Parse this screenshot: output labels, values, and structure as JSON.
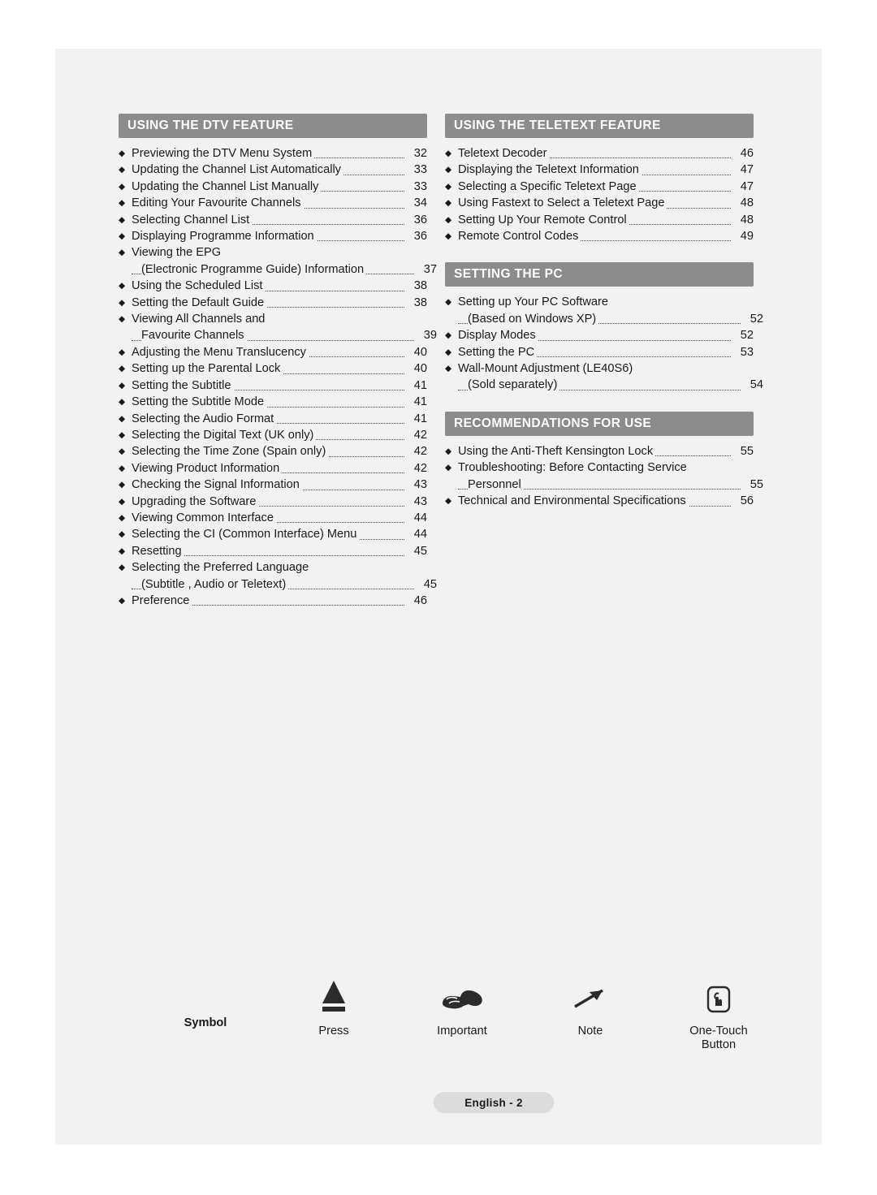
{
  "page": {
    "footer_label": "English - 2"
  },
  "sections": [
    {
      "id": "dtv",
      "title": "USING THE DTV FEATURE",
      "column": "left",
      "items": [
        {
          "text": "Previewing the DTV Menu System",
          "page": "32",
          "bullet": true,
          "dots": true
        },
        {
          "text": "Updating the Channel List Automatically",
          "page": "33",
          "bullet": true,
          "dots": true
        },
        {
          "text": "Updating the Channel List Manually",
          "page": "33",
          "bullet": true,
          "dots": true
        },
        {
          "text": "Editing Your Favourite Channels",
          "page": "34",
          "bullet": true,
          "dots": true
        },
        {
          "text": "Selecting Channel List",
          "page": "36",
          "bullet": true,
          "dots": true
        },
        {
          "text": "Displaying Programme Information",
          "page": "36",
          "bullet": true,
          "dots": true
        },
        {
          "text": "Viewing the EPG",
          "page": "",
          "bullet": true,
          "dots": false
        },
        {
          "text": "(Electronic Programme Guide) Information",
          "page": "37",
          "bullet": false,
          "dots": true,
          "indent": true
        },
        {
          "text": "Using the Scheduled List",
          "page": "38",
          "bullet": true,
          "dots": true
        },
        {
          "text": "Setting the Default Guide",
          "page": "38",
          "bullet": true,
          "dots": true
        },
        {
          "text": "Viewing All Channels and",
          "page": "",
          "bullet": true,
          "dots": false
        },
        {
          "text": "Favourite Channels",
          "page": "39",
          "bullet": false,
          "dots": true,
          "indent": true
        },
        {
          "text": "Adjusting the Menu Translucency",
          "page": "40",
          "bullet": true,
          "dots": true
        },
        {
          "text": "Setting up the Parental Lock",
          "page": "40",
          "bullet": true,
          "dots": true
        },
        {
          "text": "Setting the Subtitle",
          "page": "41",
          "bullet": true,
          "dots": true
        },
        {
          "text": "Setting the Subtitle Mode",
          "page": "41",
          "bullet": true,
          "dots": true
        },
        {
          "text": "Selecting the Audio Format",
          "page": "41",
          "bullet": true,
          "dots": true
        },
        {
          "text": "Selecting the Digital Text (UK only)",
          "page": "42",
          "bullet": true,
          "dots": true
        },
        {
          "text": "Selecting the Time Zone (Spain only)",
          "page": "42",
          "bullet": true,
          "dots": true
        },
        {
          "text": "Viewing Product Information",
          "page": "42",
          "bullet": true,
          "dots": true
        },
        {
          "text": "Checking the Signal Information",
          "page": "43",
          "bullet": true,
          "dots": true
        },
        {
          "text": "Upgrading the Software",
          "page": "43",
          "bullet": true,
          "dots": true
        },
        {
          "text": "Viewing Common Interface",
          "page": "44",
          "bullet": true,
          "dots": true
        },
        {
          "text": "Selecting the CI (Common Interface) Menu",
          "page": "44",
          "bullet": true,
          "dots": true
        },
        {
          "text": "Resetting",
          "page": "45",
          "bullet": true,
          "dots": true
        },
        {
          "text": "Selecting the Preferred Language",
          "page": "",
          "bullet": true,
          "dots": false
        },
        {
          "text": "(Subtitle , Audio or Teletext)",
          "page": "45",
          "bullet": false,
          "dots": true,
          "indent": true
        },
        {
          "text": "Preference",
          "page": "46",
          "bullet": true,
          "dots": true
        }
      ]
    },
    {
      "id": "teletext",
      "title": "USING THE TELETEXT FEATURE",
      "column": "right",
      "items": [
        {
          "text": "Teletext Decoder",
          "page": "46",
          "bullet": true,
          "dots": true
        },
        {
          "text": "Displaying the Teletext Information",
          "page": "47",
          "bullet": true,
          "dots": true
        },
        {
          "text": "Selecting a Specific Teletext Page",
          "page": "47",
          "bullet": true,
          "dots": true
        },
        {
          "text": "Using Fastext to Select a Teletext Page",
          "page": "48",
          "bullet": true,
          "dots": true
        },
        {
          "text": "Setting Up Your Remote Control",
          "page": "48",
          "bullet": true,
          "dots": true
        },
        {
          "text": "Remote Control Codes",
          "page": "49",
          "bullet": true,
          "dots": true
        }
      ]
    },
    {
      "id": "pc",
      "title": "SETTING THE PC",
      "column": "right",
      "items": [
        {
          "text": "Setting up Your PC Software",
          "page": "",
          "bullet": true,
          "dots": false
        },
        {
          "text": "(Based on Windows XP)",
          "page": "52",
          "bullet": false,
          "dots": true,
          "indent": true
        },
        {
          "text": "Display Modes",
          "page": "52",
          "bullet": true,
          "dots": true
        },
        {
          "text": "Setting the PC",
          "page": "53",
          "bullet": true,
          "dots": true
        },
        {
          "text": "Wall-Mount Adjustment (LE40S6)",
          "page": "",
          "bullet": true,
          "dots": false
        },
        {
          "text": "(Sold separately)",
          "page": "54",
          "bullet": false,
          "dots": true,
          "indent": true
        }
      ]
    },
    {
      "id": "recommendations",
      "title": "RECOMMENDATIONS FOR USE",
      "column": "right",
      "items": [
        {
          "text": "Using the Anti-Theft Kensington Lock",
          "page": "55",
          "bullet": true,
          "dots": true
        },
        {
          "text": "Troubleshooting: Before Contacting Service",
          "page": "",
          "bullet": true,
          "dots": false
        },
        {
          "text": "Personnel",
          "page": "55",
          "bullet": false,
          "dots": true,
          "indent": true
        },
        {
          "text": "Technical and Environmental Specifications",
          "page": "56",
          "bullet": true,
          "dots": true
        }
      ]
    }
  ],
  "legend": {
    "symbol_label": "Symbol",
    "entries": [
      {
        "icon": "triangle-press-icon",
        "label": "Press"
      },
      {
        "icon": "pointing-hand-icon",
        "label": "Important"
      },
      {
        "icon": "arrow-note-icon",
        "label": "Note"
      },
      {
        "icon": "one-touch-button-icon",
        "label": "One-Touch\nButton"
      }
    ]
  },
  "colors": {
    "section_header_bg": "#8c8c8c",
    "page_bg": "#f2f2f2",
    "badge_bg": "#dcdcdc",
    "text": "#1a1a1a"
  }
}
